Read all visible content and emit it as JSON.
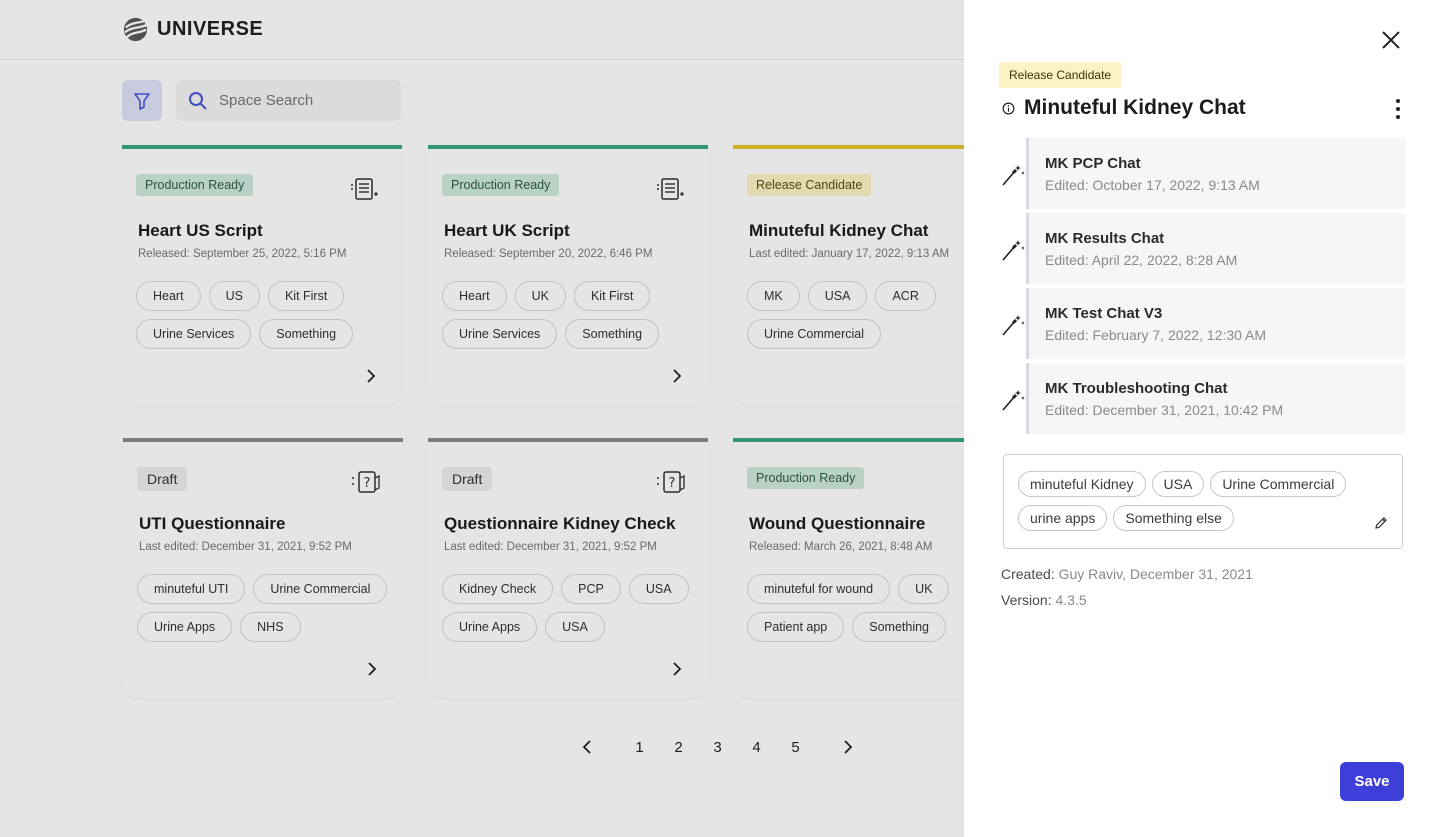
{
  "app": {
    "logo_text": "UNIVERSE",
    "search": {
      "placeholder": "Space Search",
      "value": ""
    }
  },
  "cards": [
    {
      "status": "Production Ready",
      "icon": "script-list-icon",
      "title": "Heart US Script",
      "subtitle": "Released: September 25, 2022, 5:16 PM",
      "tags": [
        "Heart",
        "US",
        "Kit First",
        "Urine Services",
        "Something"
      ]
    },
    {
      "status": "Production Ready",
      "icon": "script-list-icon",
      "title": "Heart UK Script",
      "subtitle": "Released: September 20, 2022, 6:46 PM",
      "tags": [
        "Heart",
        "UK",
        "Kit First",
        "Urine Services",
        "Something"
      ]
    },
    {
      "status": "Release Candidate",
      "icon": "chat-icon",
      "title": "Minuteful Kidney Chat",
      "subtitle": "Last edited: January 17, 2022, 9:13 AM",
      "tags": [
        "MK",
        "USA",
        "ACR",
        "Urine Commercial"
      ]
    },
    {
      "status": "Draft",
      "icon": "questionnaire-icon",
      "title": "UTI Questionnaire",
      "subtitle": "Last edited: December 31, 2021, 9:52 PM",
      "tags": [
        "minuteful UTI",
        "Urine Commercial",
        "Urine Apps",
        "NHS"
      ]
    },
    {
      "status": "Draft",
      "icon": "questionnaire-icon",
      "title": "Questionnaire Kidney Check",
      "subtitle": "Last edited: December 31, 2021, 9:52 PM",
      "tags": [
        "Kidney Check",
        "PCP",
        "USA",
        "Urine Apps",
        "USA"
      ]
    },
    {
      "status": "Production Ready",
      "icon": "questionnaire-icon",
      "title": "Wound Questionnaire",
      "subtitle": "Released: March 26, 2021, 8:48 AM",
      "tags": [
        "minuteful for wound",
        "UK",
        "Patient app",
        "Something"
      ]
    }
  ],
  "pagination": {
    "pages": [
      "1",
      "2",
      "3",
      "4",
      "5"
    ]
  },
  "drawer": {
    "status": "Release Candidate",
    "title": "Minuteful Kidney Chat",
    "chats": [
      {
        "name": "MK PCP Chat",
        "edited": "Edited: October 17, 2022, 9:13 AM"
      },
      {
        "name": "MK Results Chat",
        "edited": "Edited: April 22, 2022, 8:28 AM"
      },
      {
        "name": "MK Test Chat V3",
        "edited": "Edited: February 7, 2022, 12:30 AM"
      },
      {
        "name": "MK Troubleshooting Chat",
        "edited": "Edited: December 31, 2021, 10:42 PM"
      }
    ],
    "tags": [
      "minuteful Kidney",
      "USA",
      "Urine Commercial",
      "urine apps",
      "Something else"
    ],
    "created_label": "Created:",
    "created_value": "Guy Raviv,  December 31, 2021",
    "version_label": "Version:",
    "version_value": "4.3.5",
    "save_label": "Save"
  },
  "colors": {
    "accent": "#3d3fd8",
    "production": "#3aa982",
    "release_candidate": "#e7c32b",
    "draft": "#8a8a8a"
  }
}
